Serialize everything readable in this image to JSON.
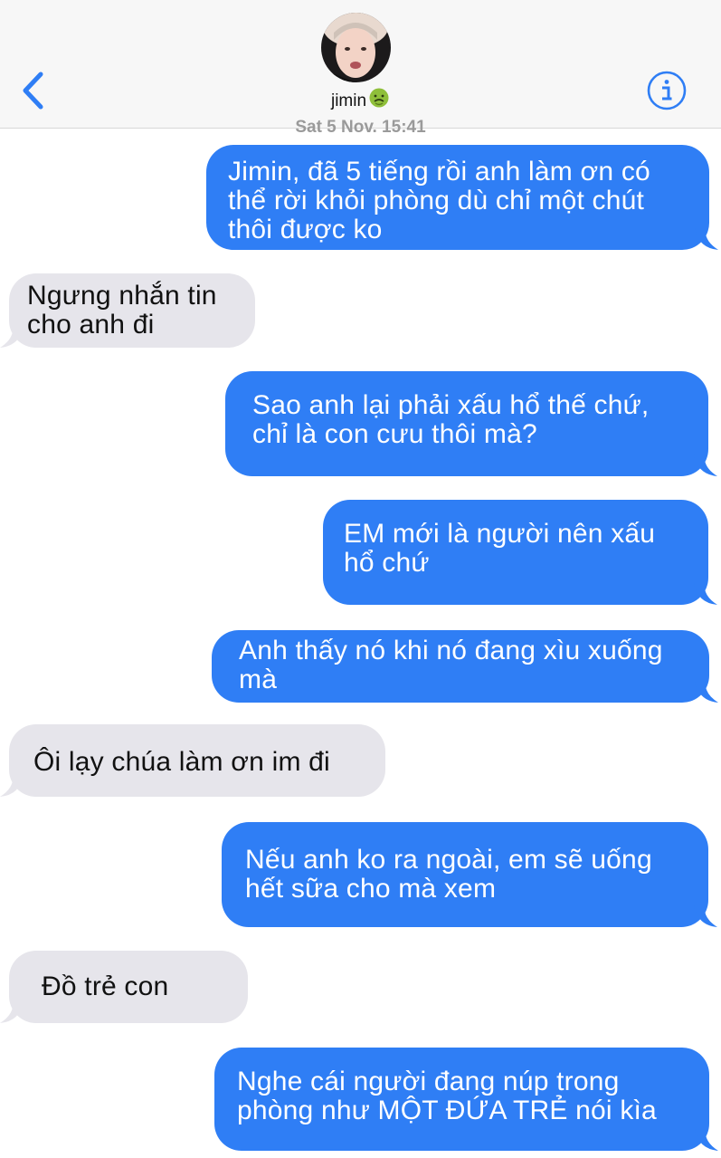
{
  "header": {
    "contact_name": "jimin",
    "contact_emoji": "🤮",
    "back_icon": "chevron-left-icon",
    "info_icon": "info-icon",
    "accent_color": "#2f7ef5"
  },
  "timestamp": "Sat 5 Nov, 15:41",
  "messages": [
    {
      "from": "me",
      "text": "Jimin, đã 5 tiếng rồi anh làm ơn có\nthể rời khỏi phòng dù chỉ một chút\nthôi được ko"
    },
    {
      "from": "them",
      "text": "Ngưng nhắn tin\ncho anh đi"
    },
    {
      "from": "me",
      "text": "Sao anh lại phải xấu hổ thế chứ,\nchỉ là con cưu thôi mà?"
    },
    {
      "from": "me",
      "text": "EM mới là người nên xấu\nhổ chứ"
    },
    {
      "from": "me",
      "text": "Anh thấy nó khi nó đang xìu xuống\nmà"
    },
    {
      "from": "them",
      "text": "Ôi lạy chúa làm ơn im đi"
    },
    {
      "from": "me",
      "text": "Nếu anh ko ra ngoài, em sẽ uống\nhết sữa cho mà xem"
    },
    {
      "from": "them",
      "text": "Đồ trẻ con"
    },
    {
      "from": "me",
      "text": "Nghe cái người đang núp trong\nphòng như MỘT ĐỨA TRẺ nói kìa"
    }
  ],
  "colors": {
    "sent_bubble": "#2f7ef5",
    "received_bubble": "#e6e5eb"
  }
}
